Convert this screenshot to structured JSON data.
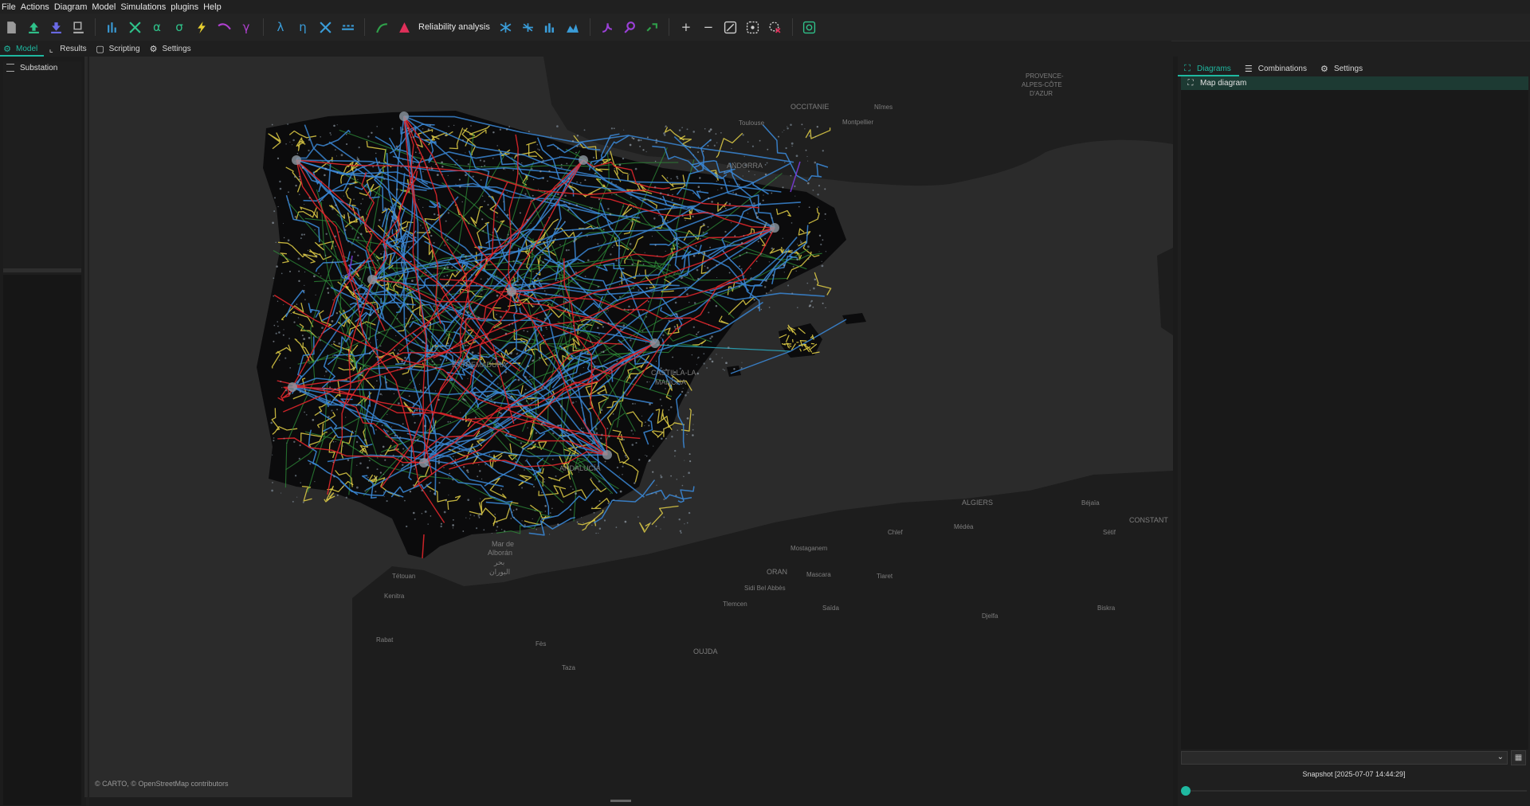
{
  "menu": [
    "File",
    "Actions",
    "Diagram",
    "Model",
    "Simulations",
    "plugins",
    "Help"
  ],
  "toolbar": {
    "reliability_label": "Reliability analysis"
  },
  "tabs": {
    "model": "Model",
    "results": "Results",
    "scripting": "Scripting",
    "settings": "Settings"
  },
  "tree": {
    "item": "Substation"
  },
  "map": {
    "attribution": "© CARTO, © OpenStreetMap contributors",
    "labels": {
      "occitanie": "OCCITANIE",
      "andorra": "ANDORRA",
      "provence1": "PROVENCE-",
      "provence2": "ALPES-CÔTE",
      "provence3": "D'AZUR",
      "toulouse": "Toulouse",
      "montpellier": "Montpellier",
      "nimes": "Nîmes",
      "extremadura": "EXTREMADURA",
      "castilla": "CASTILLA-LA",
      "mancha": "MANCHA",
      "andalucia": "ANDALUCÍA",
      "algiers": "ALGIERS",
      "constantine": "CONSTANT",
      "oujda": "OUJDA",
      "oran": "ORAN",
      "tetouan": "Tétouan",
      "chlef": "Chlef",
      "medea": "Médéa",
      "bejaia": "Béjaïa",
      "setif": "Sétif",
      "tiaret": "Tiaret",
      "djelfa": "Djelfa",
      "biskra": "Biskra",
      "mostaganem": "Mostaganem",
      "mascara": "Mascara",
      "sidi": "Sidi Bel Abbès",
      "tlemcen": "Tlemcen",
      "saida": "Saïda",
      "taza": "Taza",
      "kenitra": "Kenitra",
      "rabat": "Rabat",
      "fes": "Fès",
      "sea1": "Mar de",
      "sea2": "Alborán",
      "sea3": "بحر",
      "sea4": "البوران"
    }
  },
  "right": {
    "tabs": {
      "diagrams": "Diagrams",
      "combinations": "Combinations",
      "settings": "Settings"
    },
    "list_item": "Map diagram",
    "snapshot": "Snapshot [2025-07-07 14:44:29]"
  },
  "colors": {
    "accent": "#1fb8a0",
    "line_400kv": "#e0262b",
    "line_220kv": "#3a86d4",
    "line_132kv": "#2f8f3a",
    "line_66kv": "#e3d046",
    "line_dc": "#7a3ad8"
  },
  "icons": {
    "new": "new-file-icon",
    "open": "open-icon",
    "save": "save-icon",
    "export": "export-icon"
  }
}
